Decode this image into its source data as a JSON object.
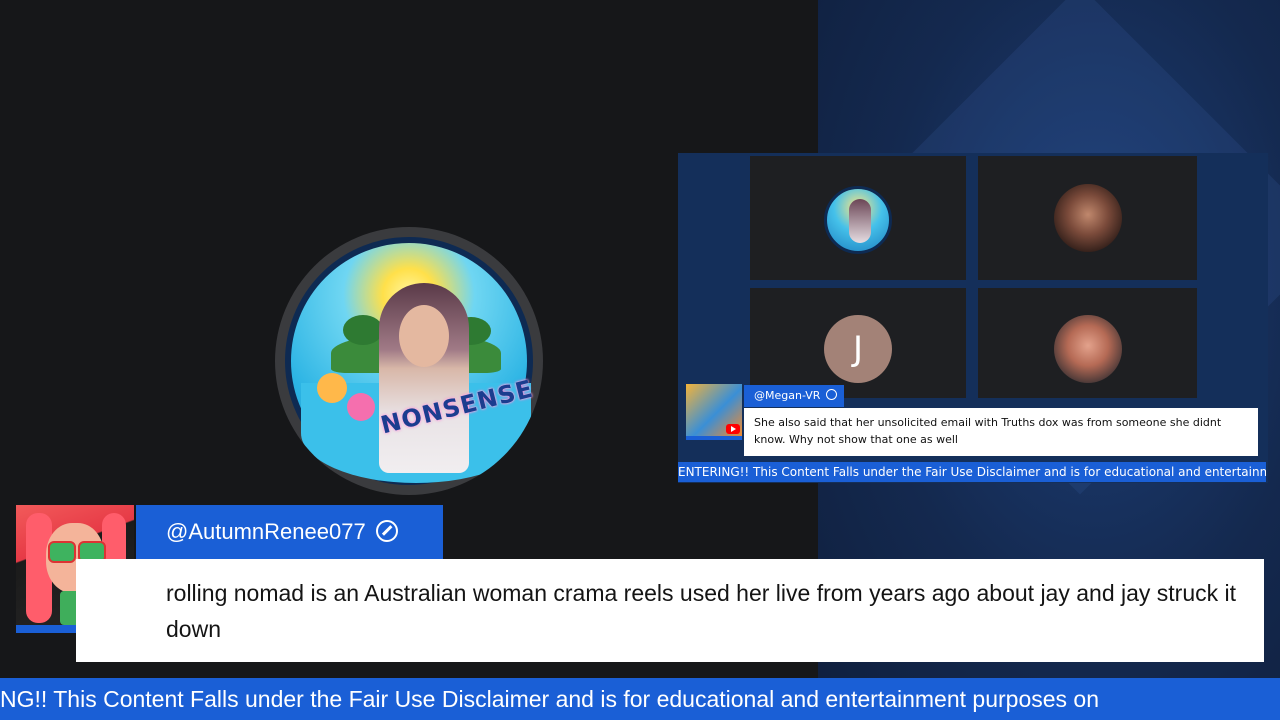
{
  "main_avatar": {
    "label": "NONSENSE",
    "icon": "nonsense-channel-logo"
  },
  "call_grid": {
    "participants": [
      {
        "icon": "nonsense-avatar"
      },
      {
        "icon": "woman-portrait-avatar"
      },
      {
        "initial": "J",
        "color": "#a38277"
      },
      {
        "icon": "man-glasses-avatar"
      }
    ]
  },
  "mini_comment": {
    "username": "@Megan-VR",
    "text": "She also said that her unsolicited email with Truths dox was from someone she didnt know. Why not show that one as well"
  },
  "mini_ticker": {
    "text": "ENTERING!! This Content Falls under the Fair Use Disclaimer and is for educational and entertainment purpo"
  },
  "comment": {
    "username": "@AutumnRenee077",
    "text": "rolling nomad is an Australian woman crama reels used her live from years ago about jay and jay struck it down"
  },
  "ticker": {
    "text": "NG!! This Content Falls under the Fair Use Disclaimer and is for educational and entertainment purposes on"
  },
  "colors": {
    "accent_blue": "#1a5fd6",
    "background": "#161719",
    "youtube_red": "#ff0000"
  }
}
